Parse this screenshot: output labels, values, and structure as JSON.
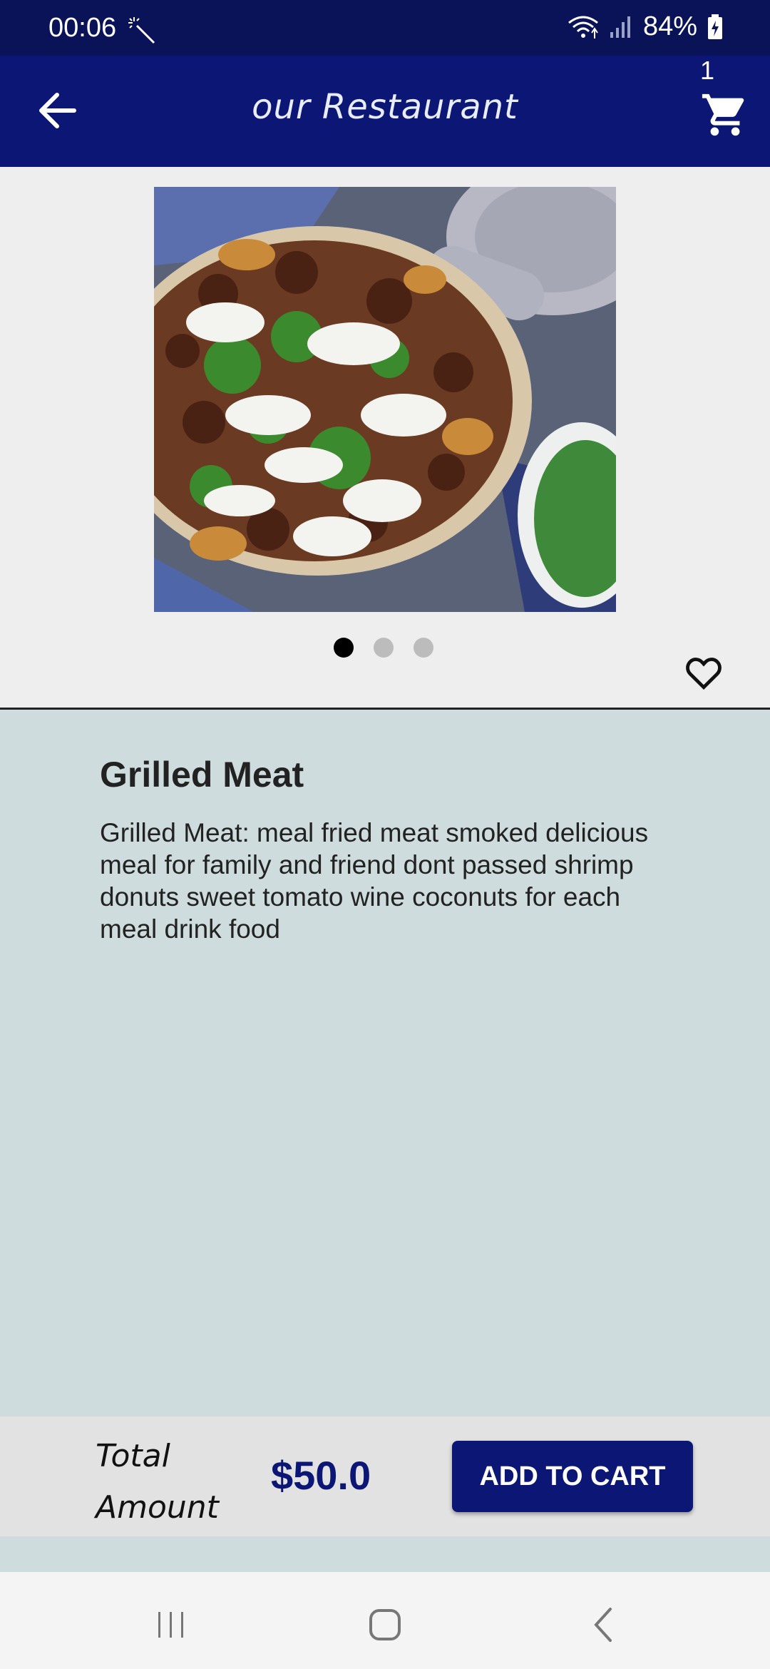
{
  "status_bar": {
    "time": "00:06",
    "battery": "84%"
  },
  "app_bar": {
    "title": "our Restaurant",
    "cart_count": "1"
  },
  "gallery": {
    "page_count": 3,
    "active_index": 0
  },
  "product": {
    "title": "Grilled Meat",
    "description": "Grilled Meat: meal fried meat smoked delicious meal for family and friend dont passed shrimp donuts sweet tomato wine coconuts for each meal drink food"
  },
  "checkout": {
    "total_label": "Total Amount",
    "price": "$50.0",
    "add_to_cart_label": "ADD TO CART"
  },
  "colors": {
    "primary": "#0c1775",
    "status_bar": "#0a1357",
    "details_bg": "#cfdcdd"
  },
  "icons": {
    "back": "arrow-left-icon",
    "cart": "shopping-cart-icon",
    "favorite": "heart-outline-icon",
    "nav_recents": "recents-icon",
    "nav_home": "home-icon",
    "nav_back": "chevron-left-icon"
  }
}
